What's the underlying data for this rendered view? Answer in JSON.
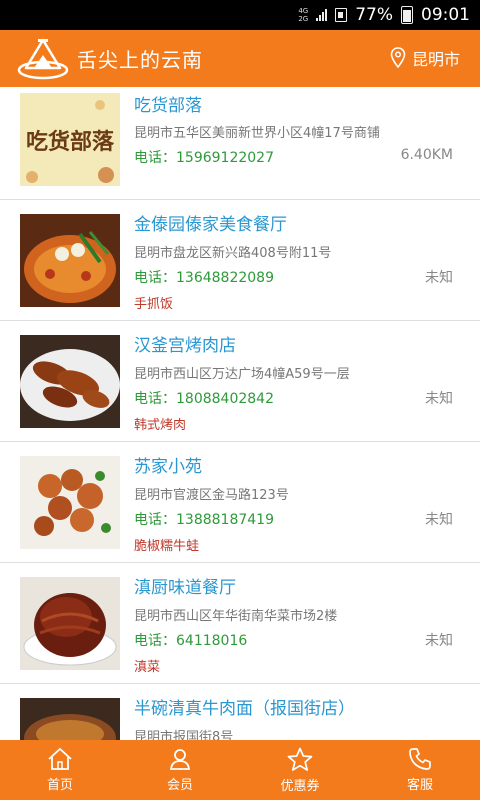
{
  "status_bar": {
    "network": "4G",
    "network2": "2G",
    "battery": "77%",
    "time": "09:01"
  },
  "header": {
    "title": "舌尖上的云南",
    "city": "昆明市"
  },
  "restaurants": [
    {
      "name": "吃货部落",
      "address": "昆明市五华区美丽新世界小区4幢17号商铺",
      "phone": "电话：15969122027",
      "distance": "6.40KM",
      "tag": "",
      "thumb_text": "吃货部落"
    },
    {
      "name": "金傣园傣家美食餐厅",
      "address": "昆明市盘龙区新兴路408号附11号",
      "phone": "电话：13648822089",
      "distance": "未知",
      "tag": "手抓饭"
    },
    {
      "name": "汉釜宫烤肉店",
      "address": "昆明市西山区万达广场4幢A59号一层",
      "phone": "电话：18088402842",
      "distance": "未知",
      "tag": "韩式烤肉"
    },
    {
      "name": "苏家小苑",
      "address": "昆明市官渡区金马路123号",
      "phone": "电话：13888187419",
      "distance": "未知",
      "tag": "脆椒糯牛蛙"
    },
    {
      "name": "滇厨味道餐厅",
      "address": "昆明市西山区年华街南华菜市场2楼",
      "phone": "电话：64118016",
      "distance": "未知",
      "tag": "滇菜"
    },
    {
      "name": "半碗清真牛肉面（报国街店）",
      "address": "昆明市报国街8号",
      "phone": "",
      "distance": "",
      "tag": ""
    }
  ],
  "tabs": [
    {
      "label": "首页",
      "icon": "home-icon"
    },
    {
      "label": "会员",
      "icon": "user-icon"
    },
    {
      "label": "优惠券",
      "icon": "star-icon"
    },
    {
      "label": "客服",
      "icon": "phone-icon"
    }
  ],
  "colors": {
    "brand": "#f47b1c",
    "name": "#2a97d0",
    "phone": "#2e9a3a",
    "tag": "#c0392b"
  }
}
